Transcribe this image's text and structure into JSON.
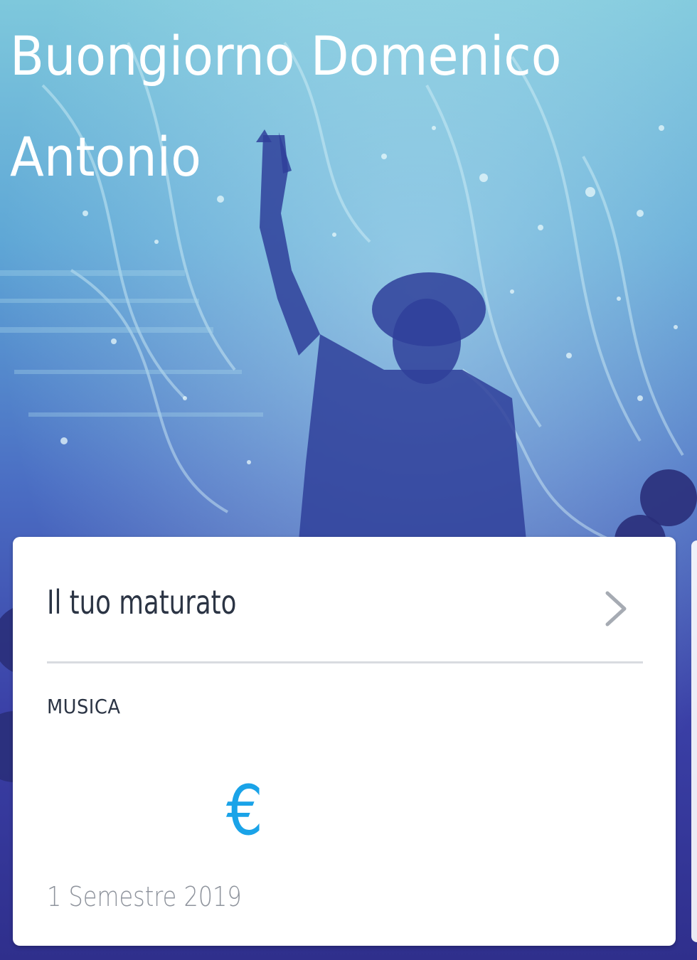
{
  "header": {
    "greeting": "Buongiorno Domenico Antonio"
  },
  "card": {
    "title": "Il tuo maturato",
    "section_label": "MUSICA",
    "amount_currency": "€",
    "period": "1 Semestre 2019",
    "chevron_icon": "chevron-right-icon"
  },
  "colors": {
    "accent": "#1aa3e8",
    "title_text": "#2b3444",
    "muted_text": "#8e939c"
  }
}
